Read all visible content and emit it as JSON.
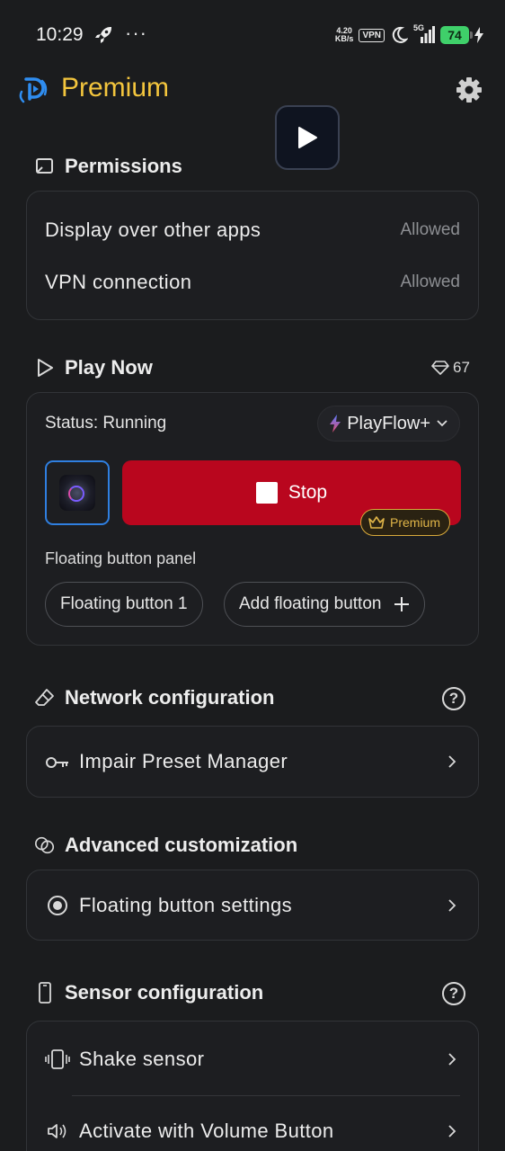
{
  "status_bar": {
    "time": "10:29",
    "more": "···",
    "net_speed_value": "4.20",
    "net_speed_unit": "KB/s",
    "vpn": "VPN",
    "network": "5G",
    "battery": "74"
  },
  "header": {
    "title": "Premium",
    "accent_color": "#f3c53d"
  },
  "permissions": {
    "title": "Permissions",
    "items": [
      {
        "label": "Display over other apps",
        "value": "Allowed"
      },
      {
        "label": "VPN connection",
        "value": "Allowed"
      }
    ]
  },
  "play_now": {
    "title": "Play Now",
    "gems": "67",
    "status": "Status: Running",
    "profile": "PlayFlow+",
    "stop_label": "Stop",
    "stop_color": "#b9061e",
    "premium_badge": "Premium",
    "panel_label": "Floating button panel",
    "chips": [
      "Floating button 1",
      "Add floating button"
    ]
  },
  "network": {
    "title": "Network configuration",
    "help": "?",
    "item": "Impair Preset Manager"
  },
  "advanced": {
    "title": "Advanced customization",
    "item": "Floating button settings"
  },
  "sensor": {
    "title": "Sensor configuration",
    "help": "?",
    "items": [
      "Shake sensor",
      "Activate with Volume Button"
    ]
  }
}
